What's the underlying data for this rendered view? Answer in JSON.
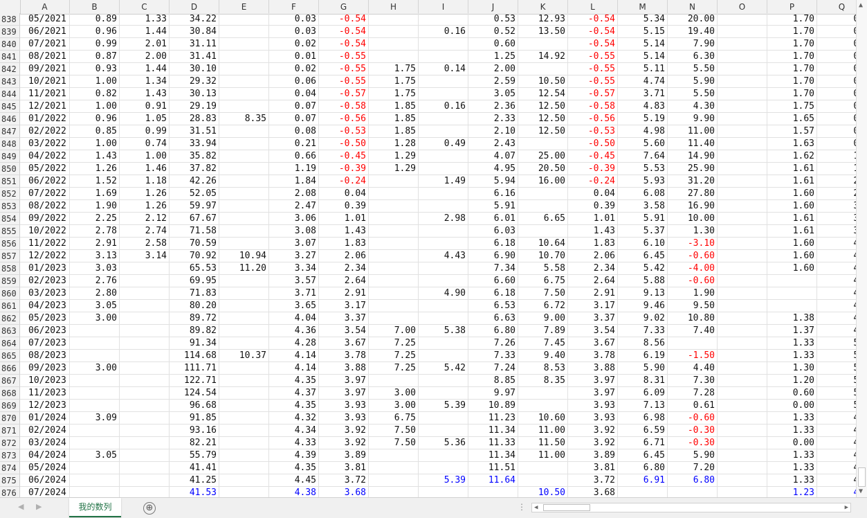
{
  "columns": [
    "A",
    "B",
    "C",
    "D",
    "E",
    "F",
    "G",
    "H",
    "I",
    "J",
    "K",
    "L",
    "M",
    "N",
    "O",
    "P",
    "Q"
  ],
  "rows": [
    {
      "n": "838",
      "c": [
        "05/2021",
        "0.89",
        "1.33",
        "34.22",
        "",
        "0.03",
        "-0.54",
        "",
        "",
        "0.53",
        "12.93",
        "-0.54",
        "5.34",
        "20.00",
        "",
        "1.70",
        "0."
      ]
    },
    {
      "n": "839",
      "c": [
        "06/2021",
        "0.96",
        "1.44",
        "30.84",
        "",
        "0.03",
        "-0.54",
        "",
        "0.16",
        "0.52",
        "13.50",
        "-0.54",
        "5.15",
        "19.40",
        "",
        "1.70",
        "0."
      ]
    },
    {
      "n": "840",
      "c": [
        "07/2021",
        "0.99",
        "2.01",
        "31.11",
        "",
        "0.02",
        "-0.54",
        "",
        "",
        "0.60",
        "",
        "-0.54",
        "5.14",
        "7.90",
        "",
        "1.70",
        "0."
      ]
    },
    {
      "n": "841",
      "c": [
        "08/2021",
        "0.87",
        "2.00",
        "31.41",
        "",
        "0.01",
        "-0.55",
        "",
        "",
        "1.25",
        "14.92",
        "-0.55",
        "5.14",
        "6.30",
        "",
        "1.70",
        "0."
      ]
    },
    {
      "n": "842",
      "c": [
        "09/2021",
        "0.93",
        "1.44",
        "30.10",
        "",
        "0.02",
        "-0.55",
        "1.75",
        "0.14",
        "2.00",
        "",
        "-0.55",
        "5.11",
        "5.50",
        "",
        "1.70",
        "0."
      ]
    },
    {
      "n": "843",
      "c": [
        "10/2021",
        "1.00",
        "1.34",
        "29.32",
        "",
        "0.06",
        "-0.55",
        "1.75",
        "",
        "2.59",
        "10.50",
        "-0.55",
        "4.74",
        "5.90",
        "",
        "1.70",
        "0."
      ]
    },
    {
      "n": "844",
      "c": [
        "11/2021",
        "0.82",
        "1.43",
        "30.13",
        "",
        "0.04",
        "-0.57",
        "1.75",
        "",
        "3.05",
        "12.54",
        "-0.57",
        "3.71",
        "5.50",
        "",
        "1.70",
        "0."
      ]
    },
    {
      "n": "845",
      "c": [
        "12/2021",
        "1.00",
        "0.91",
        "29.19",
        "",
        "0.07",
        "-0.58",
        "1.85",
        "0.16",
        "2.36",
        "12.50",
        "-0.58",
        "4.83",
        "4.30",
        "",
        "1.75",
        "0."
      ]
    },
    {
      "n": "846",
      "c": [
        "01/2022",
        "0.96",
        "1.05",
        "28.83",
        "8.35",
        "0.07",
        "-0.56",
        "1.85",
        "",
        "2.33",
        "12.50",
        "-0.56",
        "5.19",
        "9.90",
        "",
        "1.65",
        "0."
      ]
    },
    {
      "n": "847",
      "c": [
        "02/2022",
        "0.85",
        "0.99",
        "31.51",
        "",
        "0.08",
        "-0.53",
        "1.85",
        "",
        "2.10",
        "12.50",
        "-0.53",
        "4.98",
        "11.00",
        "",
        "1.57",
        "0."
      ]
    },
    {
      "n": "848",
      "c": [
        "03/2022",
        "1.00",
        "0.74",
        "33.94",
        "",
        "0.21",
        "-0.50",
        "1.28",
        "0.49",
        "2.43",
        "",
        "-0.50",
        "5.60",
        "11.40",
        "",
        "1.63",
        "0."
      ]
    },
    {
      "n": "849",
      "c": [
        "04/2022",
        "1.43",
        "1.00",
        "35.82",
        "",
        "0.66",
        "-0.45",
        "1.29",
        "",
        "4.07",
        "25.00",
        "-0.45",
        "7.64",
        "14.90",
        "",
        "1.62",
        "1."
      ]
    },
    {
      "n": "850",
      "c": [
        "05/2022",
        "1.26",
        "1.46",
        "37.82",
        "",
        "1.19",
        "-0.39",
        "1.29",
        "",
        "4.95",
        "20.50",
        "-0.39",
        "5.53",
        "25.90",
        "",
        "1.61",
        "1."
      ]
    },
    {
      "n": "851",
      "c": [
        "06/2022",
        "1.52",
        "1.18",
        "42.26",
        "",
        "1.84",
        "-0.24",
        "",
        "1.49",
        "5.94",
        "16.00",
        "-0.24",
        "5.93",
        "31.20",
        "",
        "1.61",
        "2."
      ]
    },
    {
      "n": "852",
      "c": [
        "07/2022",
        "1.69",
        "1.26",
        "52.05",
        "",
        "2.08",
        "0.04",
        "",
        "",
        "6.16",
        "",
        "0.04",
        "6.08",
        "27.80",
        "",
        "1.60",
        "2."
      ]
    },
    {
      "n": "853",
      "c": [
        "08/2022",
        "1.90",
        "1.26",
        "59.97",
        "",
        "2.47",
        "0.39",
        "",
        "",
        "5.91",
        "",
        "0.39",
        "3.58",
        "16.90",
        "",
        "1.60",
        "3."
      ]
    },
    {
      "n": "854",
      "c": [
        "09/2022",
        "2.25",
        "2.12",
        "67.67",
        "",
        "3.06",
        "1.01",
        "",
        "2.98",
        "6.01",
        "6.65",
        "1.01",
        "5.91",
        "10.00",
        "",
        "1.61",
        "3."
      ]
    },
    {
      "n": "855",
      "c": [
        "10/2022",
        "2.78",
        "2.74",
        "71.58",
        "",
        "3.08",
        "1.43",
        "",
        "",
        "6.03",
        "",
        "1.43",
        "5.37",
        "1.30",
        "",
        "1.61",
        "3."
      ]
    },
    {
      "n": "856",
      "c": [
        "11/2022",
        "2.91",
        "2.58",
        "70.59",
        "",
        "3.07",
        "1.83",
        "",
        "",
        "6.18",
        "10.64",
        "1.83",
        "6.10",
        "-3.10",
        "",
        "1.60",
        "4."
      ]
    },
    {
      "n": "857",
      "c": [
        "12/2022",
        "3.13",
        "3.14",
        "70.92",
        "10.94",
        "3.27",
        "2.06",
        "",
        "4.43",
        "6.90",
        "10.70",
        "2.06",
        "6.45",
        "-0.60",
        "",
        "1.60",
        "4."
      ]
    },
    {
      "n": "858",
      "c": [
        "01/2023",
        "3.03",
        "",
        "65.53",
        "11.20",
        "3.34",
        "2.34",
        "",
        "",
        "7.34",
        "5.58",
        "2.34",
        "5.42",
        "-4.00",
        "",
        "1.60",
        "4."
      ]
    },
    {
      "n": "859",
      "c": [
        "02/2023",
        "2.76",
        "",
        "69.95",
        "",
        "3.57",
        "2.64",
        "",
        "",
        "6.60",
        "6.75",
        "2.64",
        "5.88",
        "-0.60",
        "",
        "",
        "4."
      ]
    },
    {
      "n": "860",
      "c": [
        "03/2023",
        "2.80",
        "",
        "71.83",
        "",
        "3.71",
        "2.91",
        "",
        "4.90",
        "6.18",
        "7.50",
        "2.91",
        "9.13",
        "1.90",
        "",
        "",
        "4."
      ]
    },
    {
      "n": "861",
      "c": [
        "04/2023",
        "3.05",
        "",
        "80.20",
        "",
        "3.65",
        "3.17",
        "",
        "",
        "6.53",
        "6.72",
        "3.17",
        "9.46",
        "9.50",
        "",
        "",
        "4."
      ]
    },
    {
      "n": "862",
      "c": [
        "05/2023",
        "3.00",
        "",
        "89.72",
        "",
        "4.04",
        "3.37",
        "",
        "",
        "6.63",
        "9.00",
        "3.37",
        "9.02",
        "10.80",
        "",
        "1.38",
        "4."
      ]
    },
    {
      "n": "863",
      "c": [
        "06/2023",
        "",
        "",
        "89.82",
        "",
        "4.36",
        "3.54",
        "7.00",
        "5.38",
        "6.80",
        "7.89",
        "3.54",
        "7.33",
        "7.40",
        "",
        "1.37",
        "4."
      ]
    },
    {
      "n": "864",
      "c": [
        "07/2023",
        "",
        "",
        "91.34",
        "",
        "4.28",
        "3.67",
        "7.25",
        "",
        "7.26",
        "7.45",
        "3.67",
        "8.56",
        "",
        "",
        "1.33",
        "5."
      ]
    },
    {
      "n": "865",
      "c": [
        "08/2023",
        "",
        "",
        "114.68",
        "10.37",
        "4.14",
        "3.78",
        "7.25",
        "",
        "7.33",
        "9.40",
        "3.78",
        "6.19",
        "-1.50",
        "",
        "1.33",
        "5."
      ]
    },
    {
      "n": "866",
      "c": [
        "09/2023",
        "3.00",
        "",
        "111.71",
        "",
        "4.14",
        "3.88",
        "7.25",
        "5.42",
        "7.24",
        "8.53",
        "3.88",
        "5.90",
        "4.40",
        "",
        "1.30",
        "5."
      ]
    },
    {
      "n": "867",
      "c": [
        "10/2023",
        "",
        "",
        "122.71",
        "",
        "4.35",
        "3.97",
        "",
        "",
        "8.85",
        "8.35",
        "3.97",
        "8.31",
        "7.30",
        "",
        "1.20",
        "5."
      ]
    },
    {
      "n": "868",
      "c": [
        "11/2023",
        "",
        "",
        "124.54",
        "",
        "4.37",
        "3.97",
        "3.00",
        "",
        "9.97",
        "",
        "3.97",
        "6.09",
        "7.28",
        "",
        "0.60",
        "5."
      ]
    },
    {
      "n": "869",
      "c": [
        "12/2023",
        "",
        "",
        "96.68",
        "",
        "4.35",
        "3.93",
        "3.00",
        "5.39",
        "10.89",
        "",
        "3.93",
        "7.13",
        "0.61",
        "",
        "0.00",
        "5."
      ]
    },
    {
      "n": "870",
      "c": [
        "01/2024",
        "3.09",
        "",
        "91.85",
        "",
        "4.32",
        "3.93",
        "6.75",
        "",
        "11.23",
        "10.60",
        "3.93",
        "6.98",
        "-0.60",
        "",
        "1.33",
        "4."
      ]
    },
    {
      "n": "871",
      "c": [
        "02/2024",
        "",
        "",
        "93.16",
        "",
        "4.34",
        "3.92",
        "7.50",
        "",
        "11.34",
        "11.00",
        "3.92",
        "6.59",
        "-0.30",
        "",
        "1.33",
        "4."
      ]
    },
    {
      "n": "872",
      "c": [
        "03/2024",
        "",
        "",
        "82.21",
        "",
        "4.33",
        "3.92",
        "7.50",
        "5.36",
        "11.33",
        "11.50",
        "3.92",
        "6.71",
        "-0.30",
        "",
        "0.00",
        "4."
      ]
    },
    {
      "n": "873",
      "c": [
        "04/2024",
        "3.05",
        "",
        "55.79",
        "",
        "4.39",
        "3.89",
        "",
        "",
        "11.34",
        "11.00",
        "3.89",
        "6.45",
        "5.90",
        "",
        "1.33",
        "4."
      ]
    },
    {
      "n": "874",
      "c": [
        "05/2024",
        "",
        "",
        "41.41",
        "",
        "4.35",
        "3.81",
        "",
        "",
        "11.51",
        "",
        "3.81",
        "6.80",
        "7.20",
        "",
        "1.33",
        "4."
      ]
    },
    {
      "n": "875",
      "c": [
        "06/2024",
        "",
        "",
        "41.25",
        "",
        "4.45",
        "3.72",
        "",
        "5.39",
        "11.64",
        "",
        "3.72",
        "6.91",
        "6.80",
        "",
        "1.33",
        "4."
      ]
    },
    {
      "n": "876",
      "c": [
        "07/2024",
        "",
        "",
        "41.53",
        "",
        "4.38",
        "3.68",
        "",
        "",
        "",
        "10.50",
        "3.68",
        "",
        "",
        "",
        "1.23",
        "4."
      ]
    }
  ],
  "blue_cells": {
    "875": [
      "I",
      "J",
      "M",
      "N"
    ],
    "876": [
      "D",
      "F",
      "G",
      "K",
      "P",
      "Q"
    ]
  },
  "colors": {
    "negative": "#ff0000",
    "latest": "#0000ff",
    "accent": "#217346"
  },
  "sheet_tab": "我的数列",
  "add_sheet_icon": "⊕",
  "more_icon": "⋮"
}
